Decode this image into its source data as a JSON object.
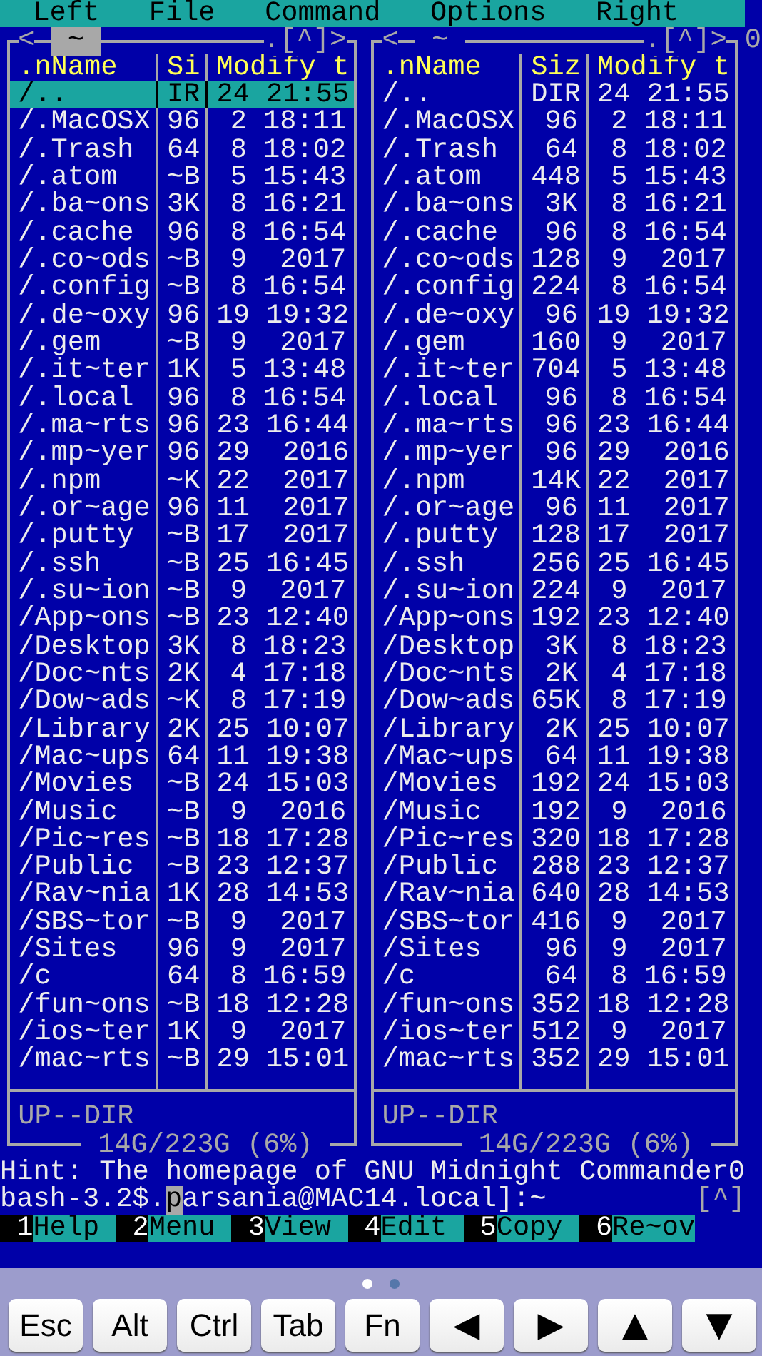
{
  "menu_bar": [
    {
      "label": "Left"
    },
    {
      "label": "File"
    },
    {
      "label": "Command"
    },
    {
      "label": "Options"
    },
    {
      "label": "Right"
    }
  ],
  "panels": [
    {
      "active": true,
      "nav_left": "<",
      "path": "~",
      "hidden_toggle": ".",
      "hotlist": "[^]",
      "nav_right": ">",
      "columns": [
        ".nName",
        "Si",
        "Modify t"
      ],
      "rows": [
        {
          "name": "/..",
          "size": "IR",
          "modified": "24 21:55",
          "selected": true
        },
        {
          "name": "/.MacOSX",
          "size": "96",
          "modified": "2 18:11",
          "selected": false
        },
        {
          "name": "/.Trash",
          "size": "64",
          "modified": "8 18:02",
          "selected": false
        },
        {
          "name": "/.atom",
          "size": "~B",
          "modified": "5 15:43",
          "selected": false
        },
        {
          "name": "/.ba~ons",
          "size": "3K",
          "modified": "8 16:21",
          "selected": false
        },
        {
          "name": "/.cache",
          "size": "96",
          "modified": "8 16:54",
          "selected": false
        },
        {
          "name": "/.co~ods",
          "size": "~B",
          "modified": "9  2017",
          "selected": false
        },
        {
          "name": "/.config",
          "size": "~B",
          "modified": "8 16:54",
          "selected": false
        },
        {
          "name": "/.de~oxy",
          "size": "96",
          "modified": "19 19:32",
          "selected": false
        },
        {
          "name": "/.gem",
          "size": "~B",
          "modified": "9  2017",
          "selected": false
        },
        {
          "name": "/.it~ter",
          "size": "1K",
          "modified": "5 13:48",
          "selected": false
        },
        {
          "name": "/.local",
          "size": "96",
          "modified": "8 16:54",
          "selected": false
        },
        {
          "name": "/.ma~rts",
          "size": "96",
          "modified": "23 16:44",
          "selected": false
        },
        {
          "name": "/.mp~yer",
          "size": "96",
          "modified": "29  2016",
          "selected": false
        },
        {
          "name": "/.npm",
          "size": "~K",
          "modified": "22  2017",
          "selected": false
        },
        {
          "name": "/.or~age",
          "size": "96",
          "modified": "11  2017",
          "selected": false
        },
        {
          "name": "/.putty",
          "size": "~B",
          "modified": "17  2017",
          "selected": false
        },
        {
          "name": "/.ssh",
          "size": "~B",
          "modified": "25 16:45",
          "selected": false
        },
        {
          "name": "/.su~ion",
          "size": "~B",
          "modified": "9  2017",
          "selected": false
        },
        {
          "name": "/App~ons",
          "size": "~B",
          "modified": "23 12:40",
          "selected": false
        },
        {
          "name": "/Desktop",
          "size": "3K",
          "modified": "8 18:23",
          "selected": false
        },
        {
          "name": "/Doc~nts",
          "size": "2K",
          "modified": "4 17:18",
          "selected": false
        },
        {
          "name": "/Dow~ads",
          "size": "~K",
          "modified": "8 17:19",
          "selected": false
        },
        {
          "name": "/Library",
          "size": "2K",
          "modified": "25 10:07",
          "selected": false
        },
        {
          "name": "/Mac~ups",
          "size": "64",
          "modified": "11 19:38",
          "selected": false
        },
        {
          "name": "/Movies",
          "size": "~B",
          "modified": "24 15:03",
          "selected": false
        },
        {
          "name": "/Music",
          "size": "~B",
          "modified": "9  2016",
          "selected": false
        },
        {
          "name": "/Pic~res",
          "size": "~B",
          "modified": "18 17:28",
          "selected": false
        },
        {
          "name": "/Public",
          "size": "~B",
          "modified": "23 12:37",
          "selected": false
        },
        {
          "name": "/Rav~nia",
          "size": "1K",
          "modified": "28 14:53",
          "selected": false
        },
        {
          "name": "/SBS~tor",
          "size": "~B",
          "modified": "9  2017",
          "selected": false
        },
        {
          "name": "/Sites",
          "size": "96",
          "modified": "9  2017",
          "selected": false
        },
        {
          "name": "/c",
          "size": "64",
          "modified": "8 16:59",
          "selected": false
        },
        {
          "name": "/fun~ons",
          "size": "~B",
          "modified": "18 12:28",
          "selected": false
        },
        {
          "name": "/ios~ter",
          "size": "1K",
          "modified": "9  2017",
          "selected": false
        },
        {
          "name": "/mac~rts",
          "size": "~B",
          "modified": "29 15:01",
          "selected": false
        }
      ],
      "info": "UP--DIR",
      "disk": "14G/223G (6%)"
    },
    {
      "active": false,
      "nav_left": "<",
      "path": "~",
      "hidden_toggle": ".",
      "hotlist": "[^]",
      "nav_right": ">",
      "columns": [
        ".nName",
        "Siz",
        "Modify t"
      ],
      "rows": [
        {
          "name": "/..",
          "size": "DIR",
          "modified": "24 21:55",
          "selected": false
        },
        {
          "name": "/.MacOSX",
          "size": "96",
          "modified": "2 18:11",
          "selected": false
        },
        {
          "name": "/.Trash",
          "size": "64",
          "modified": "8 18:02",
          "selected": false
        },
        {
          "name": "/.atom",
          "size": "448",
          "modified": "5 15:43",
          "selected": false
        },
        {
          "name": "/.ba~ons",
          "size": "3K",
          "modified": "8 16:21",
          "selected": false
        },
        {
          "name": "/.cache",
          "size": "96",
          "modified": "8 16:54",
          "selected": false
        },
        {
          "name": "/.co~ods",
          "size": "128",
          "modified": "9  2017",
          "selected": false
        },
        {
          "name": "/.config",
          "size": "224",
          "modified": "8 16:54",
          "selected": false
        },
        {
          "name": "/.de~oxy",
          "size": "96",
          "modified": "19 19:32",
          "selected": false
        },
        {
          "name": "/.gem",
          "size": "160",
          "modified": "9  2017",
          "selected": false
        },
        {
          "name": "/.it~ter",
          "size": "704",
          "modified": "5 13:48",
          "selected": false
        },
        {
          "name": "/.local",
          "size": "96",
          "modified": "8 16:54",
          "selected": false
        },
        {
          "name": "/.ma~rts",
          "size": "96",
          "modified": "23 16:44",
          "selected": false
        },
        {
          "name": "/.mp~yer",
          "size": "96",
          "modified": "29  2016",
          "selected": false
        },
        {
          "name": "/.npm",
          "size": "14K",
          "modified": "22  2017",
          "selected": false
        },
        {
          "name": "/.or~age",
          "size": "96",
          "modified": "11  2017",
          "selected": false
        },
        {
          "name": "/.putty",
          "size": "128",
          "modified": "17  2017",
          "selected": false
        },
        {
          "name": "/.ssh",
          "size": "256",
          "modified": "25 16:45",
          "selected": false
        },
        {
          "name": "/.su~ion",
          "size": "224",
          "modified": "9  2017",
          "selected": false
        },
        {
          "name": "/App~ons",
          "size": "192",
          "modified": "23 12:40",
          "selected": false
        },
        {
          "name": "/Desktop",
          "size": "3K",
          "modified": "8 18:23",
          "selected": false
        },
        {
          "name": "/Doc~nts",
          "size": "2K",
          "modified": "4 17:18",
          "selected": false
        },
        {
          "name": "/Dow~ads",
          "size": "65K",
          "modified": "8 17:19",
          "selected": false
        },
        {
          "name": "/Library",
          "size": "2K",
          "modified": "25 10:07",
          "selected": false
        },
        {
          "name": "/Mac~ups",
          "size": "64",
          "modified": "11 19:38",
          "selected": false
        },
        {
          "name": "/Movies",
          "size": "192",
          "modified": "24 15:03",
          "selected": false
        },
        {
          "name": "/Music",
          "size": "192",
          "modified": "9  2016",
          "selected": false
        },
        {
          "name": "/Pic~res",
          "size": "320",
          "modified": "18 17:28",
          "selected": false
        },
        {
          "name": "/Public",
          "size": "288",
          "modified": "23 12:37",
          "selected": false
        },
        {
          "name": "/Rav~nia",
          "size": "640",
          "modified": "28 14:53",
          "selected": false
        },
        {
          "name": "/SBS~tor",
          "size": "416",
          "modified": "9  2017",
          "selected": false
        },
        {
          "name": "/Sites",
          "size": "96",
          "modified": "9  2017",
          "selected": false
        },
        {
          "name": "/c",
          "size": "64",
          "modified": "8 16:59",
          "selected": false
        },
        {
          "name": "/fun~ons",
          "size": "352",
          "modified": "18 12:28",
          "selected": false
        },
        {
          "name": "/ios~ter",
          "size": "512",
          "modified": "9  2017",
          "selected": false
        },
        {
          "name": "/mac~rts",
          "size": "352",
          "modified": "29 15:01",
          "selected": false
        }
      ],
      "info": "UP--DIR",
      "disk": "14G/223G (6%)"
    }
  ],
  "corner": "0",
  "hint": "Hint: The homepage of GNU Midnight Commander0",
  "command_line": {
    "prompt": "bash-3.2$.",
    "cursor": "p",
    "text": "arsania@MAC14.local]:~",
    "history": "[^]"
  },
  "function_keys": [
    {
      "number": "1",
      "label": "Help"
    },
    {
      "number": "2",
      "label": "Menu"
    },
    {
      "number": "3",
      "label": "View"
    },
    {
      "number": "4",
      "label": "Edit"
    },
    {
      "number": "5",
      "label": "Copy"
    },
    {
      "number": "6",
      "label": "Re~ov"
    }
  ],
  "page_dots": [
    {
      "selected": true
    },
    {
      "selected": false
    }
  ],
  "accessory_keys": [
    {
      "kind": "text",
      "label": "Esc"
    },
    {
      "kind": "text",
      "label": "Alt"
    },
    {
      "kind": "text",
      "label": "Ctrl"
    },
    {
      "kind": "text",
      "label": "Tab"
    },
    {
      "kind": "text",
      "label": "Fn"
    },
    {
      "kind": "arrow",
      "glyph": "◀"
    },
    {
      "kind": "arrow",
      "glyph": "▶"
    },
    {
      "kind": "arrow",
      "glyph": "▲"
    },
    {
      "kind": "arrow",
      "glyph": "▼"
    }
  ]
}
